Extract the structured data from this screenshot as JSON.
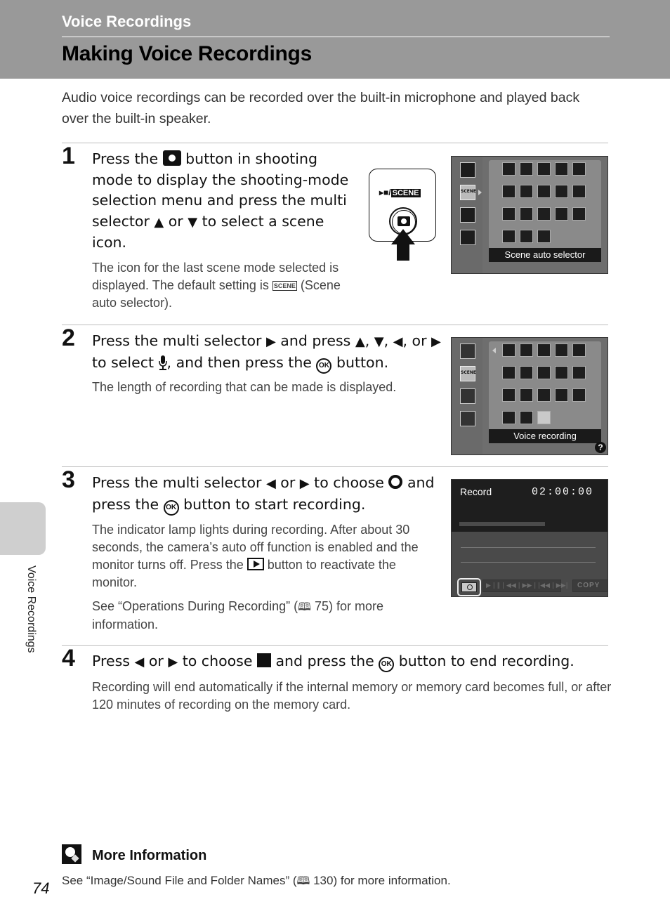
{
  "header": {
    "section_title": "Voice Recordings",
    "page_title": "Making Voice Recordings"
  },
  "intro": "Audio voice recordings can be recorded over the built-in microphone and played back over the built-in speaker.",
  "steps": [
    {
      "number": "1",
      "head_parts": [
        "Press the ",
        " button in shooting mode to display the shooting-mode selection menu and press the multi selector ",
        " or ",
        " to select a scene icon."
      ],
      "body_parts": [
        "The icon for the last scene mode selected is displayed. The default setting is ",
        " (Scene auto selector)."
      ],
      "illustration": {
        "button_label_prefix": "/",
        "button_label_scene": "SCENE"
      },
      "screen": {
        "caption": "Scene auto selector",
        "side_icons": [
          "shooting-mode-camera",
          "scene-auto-selector",
          "smart-portrait",
          "movie"
        ],
        "grid_icons": [
          [
            "scene-auto",
            "portrait",
            "landscape",
            "sports",
            "night-portrait"
          ],
          [
            "party-indoor",
            "beach",
            "snow",
            "sunset",
            "dusk-dawn"
          ],
          [
            "night-landscape",
            "close-up",
            "food",
            "museum",
            "fireworks"
          ],
          [
            "copy",
            "backlighting",
            "panorama-assist",
            "voice-recording"
          ]
        ]
      }
    },
    {
      "number": "2",
      "head_parts": [
        "Press the multi selector ",
        " and press ",
        ", ",
        ", ",
        ", or ",
        " to select ",
        ", and then press the ",
        " button."
      ],
      "body": "The length of recording that can be made is displayed.",
      "screen": {
        "caption": "Voice recording",
        "help_label": "?",
        "selected_icon": "voice-recording"
      }
    },
    {
      "number": "3",
      "head_parts": [
        "Press the multi selector ",
        " or ",
        " to choose ",
        " and press the ",
        " button to start recording."
      ],
      "body_parts": [
        "The indicator lamp lights during recording. After about 30 seconds, the camera’s auto off function is enabled and the monitor turns off. Press the ",
        " button to reactivate the monitor."
      ],
      "body2_parts": [
        "See “Operations During Recording” (",
        " 75) for more information."
      ],
      "screen": {
        "label": "Record",
        "time": "02:00:00",
        "controls": "▶ | ‖ | ◀◀ | ▶▶ | |◀◀ | ▶▶|",
        "copy_label": "COPY"
      }
    },
    {
      "number": "4",
      "head_parts": [
        "Press ",
        " or ",
        " to choose ",
        " and press the ",
        " button to end recording."
      ],
      "body": "Recording will end automatically if the internal memory or memory card becomes full, or after 120 minutes of recording on the memory card."
    }
  ],
  "glyphs": {
    "up": "▲",
    "down": "▼",
    "left": "◀",
    "right": "▶",
    "ok": "OK",
    "book": "🕮",
    "scene": "SCENE"
  },
  "more_info": {
    "title": "More Information",
    "body_parts": [
      "See “Image/Sound File and Folder Names” (",
      " 130) for more information."
    ]
  },
  "side_tab_label": "Voice Recordings",
  "page_number": "74"
}
